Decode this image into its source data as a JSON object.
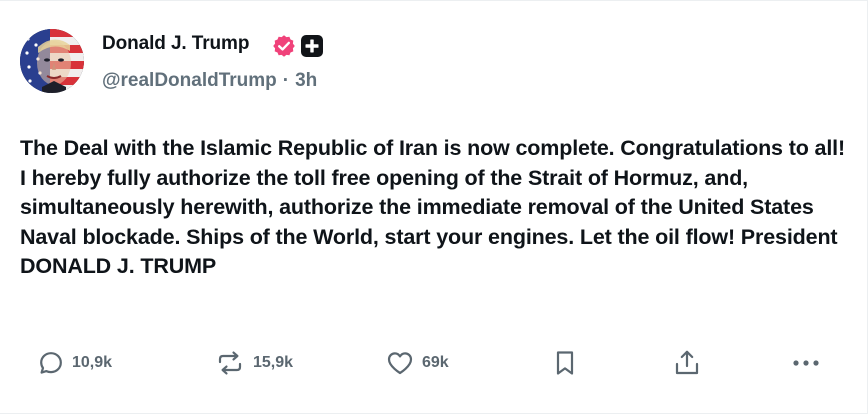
{
  "author": {
    "display_name": "Donald J. Trump",
    "handle": "@realDonaldTrump",
    "separator": "·",
    "time_ago": "3h"
  },
  "post": {
    "text": "The Deal with the Islamic Republic of Iran is now complete. Congratulations to all! I hereby fully authorize the toll free opening of the Strait of Hormuz, and, simultaneously herewith, authorize the immediate removal of the United States Naval blockade. Ships of the World, start your engines. Let the oil flow! President DONALD J. TRUMP"
  },
  "actions": {
    "reply_count": "10,9k",
    "repost_count": "15,9k",
    "like_count": "69k"
  },
  "icons": {
    "verified": "verified-badge-icon",
    "plus": "plus-badge-icon",
    "reply": "speech-bubble-icon",
    "repost": "repost-arrows-icon",
    "like": "heart-icon",
    "bookmark": "bookmark-icon",
    "share": "share-upload-icon",
    "more": "more-dots-icon"
  },
  "colors": {
    "verified_badge": "#f0427a",
    "text_primary": "#0f1419",
    "text_secondary": "#61707b",
    "icon_gray": "#5b6770"
  }
}
